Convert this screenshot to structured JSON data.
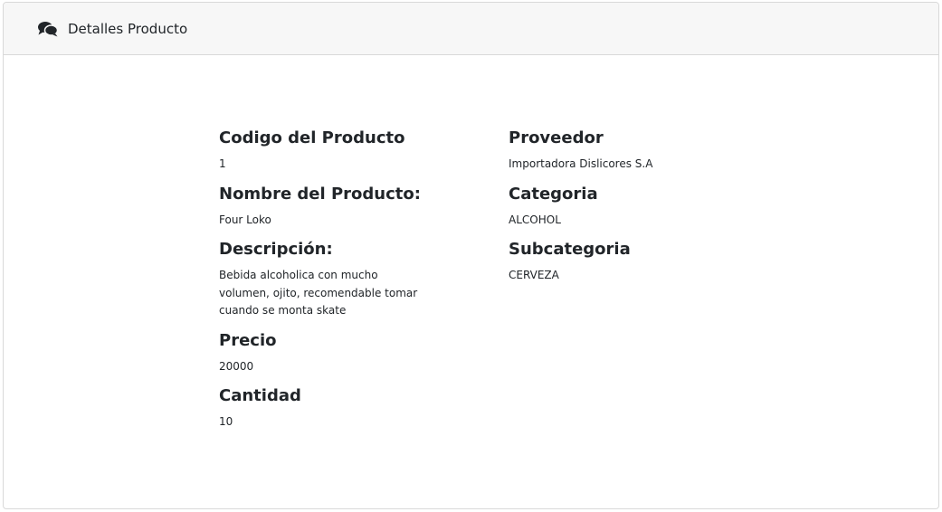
{
  "header": {
    "icon": "comments-icon",
    "title": "Detalles Producto"
  },
  "left_column": [
    {
      "label": "Codigo del Producto",
      "value": "1"
    },
    {
      "label": "Nombre del Producto:",
      "value": "Four Loko"
    },
    {
      "label": "Descripción:",
      "value": "Bebida alcoholica con mucho volumen, ojito, recomendable tomar cuando se monta skate"
    },
    {
      "label": "Precio",
      "value": "20000"
    },
    {
      "label": "Cantidad",
      "value": "10"
    }
  ],
  "right_column": [
    {
      "label": "Proveedor",
      "value": "Importadora Dislicores S.A"
    },
    {
      "label": "Categoria",
      "value": "ALCOHOL"
    },
    {
      "label": "Subcategoria",
      "value": "CERVEZA"
    }
  ]
}
